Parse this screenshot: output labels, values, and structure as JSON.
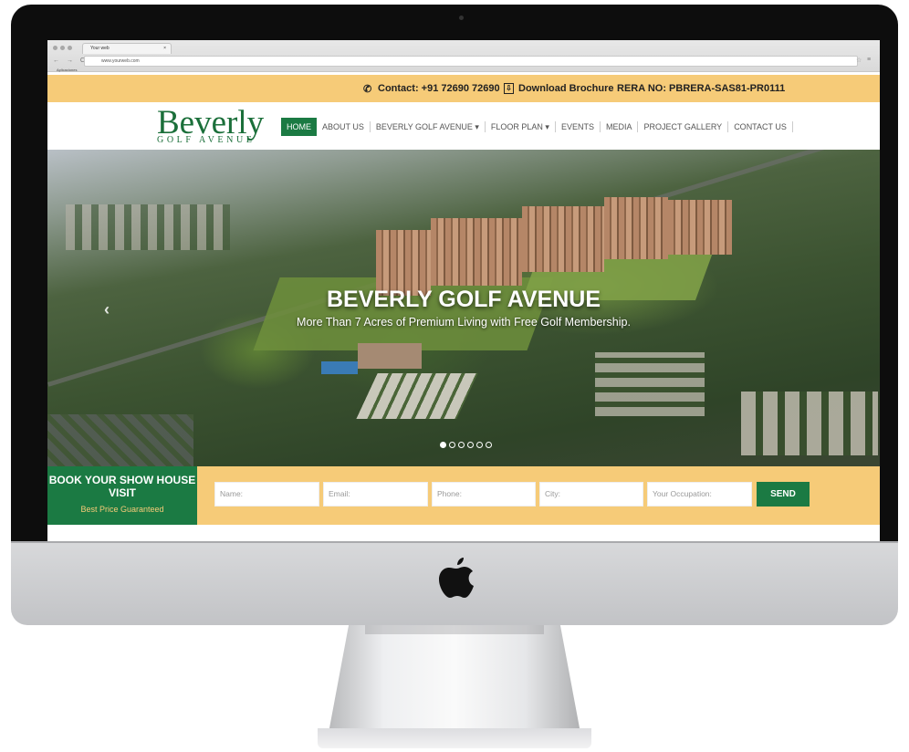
{
  "browser": {
    "tab_title": "Your web",
    "tab_close": "×",
    "url": "www.yourweb.com",
    "bookmark": "Aplicaciones",
    "nav_glyphs": "← → C"
  },
  "topbar": {
    "contact": "Contact: +91 72690 72690",
    "download": "Download Brochure",
    "rera": "RERA NO: PBRERA-SAS81-PR0111"
  },
  "logo": {
    "main": "Beverly",
    "sub": "GOLF AVENUE"
  },
  "nav": {
    "items": [
      "HOME",
      "ABOUT US",
      "BEVERLY GOLF AVENUE ▾",
      "FLOOR PLAN ▾",
      "EVENTS",
      "MEDIA",
      "PROJECT GALLERY",
      "CONTACT US"
    ]
  },
  "hero": {
    "title": "BEVERLY GOLF AVENUE",
    "subtitle": "More Than 7 Acres of Premium Living with Free Golf Membership.",
    "slide_count": 6,
    "active_slide": 1
  },
  "booking": {
    "title": "BOOK YOUR SHOW HOUSE VISIT",
    "tagline": "Best Price Guaranteed",
    "fields": [
      "Name:",
      "Email:",
      "Phone:",
      "City:",
      "Your Occupation:"
    ],
    "send": "SEND"
  },
  "colors": {
    "brand_green": "#1b7a43",
    "accent_yellow": "#f6cb78"
  },
  "icons": [
    "phone-icon",
    "download-icon",
    "chevron-left-icon",
    "apple-logo-icon"
  ]
}
